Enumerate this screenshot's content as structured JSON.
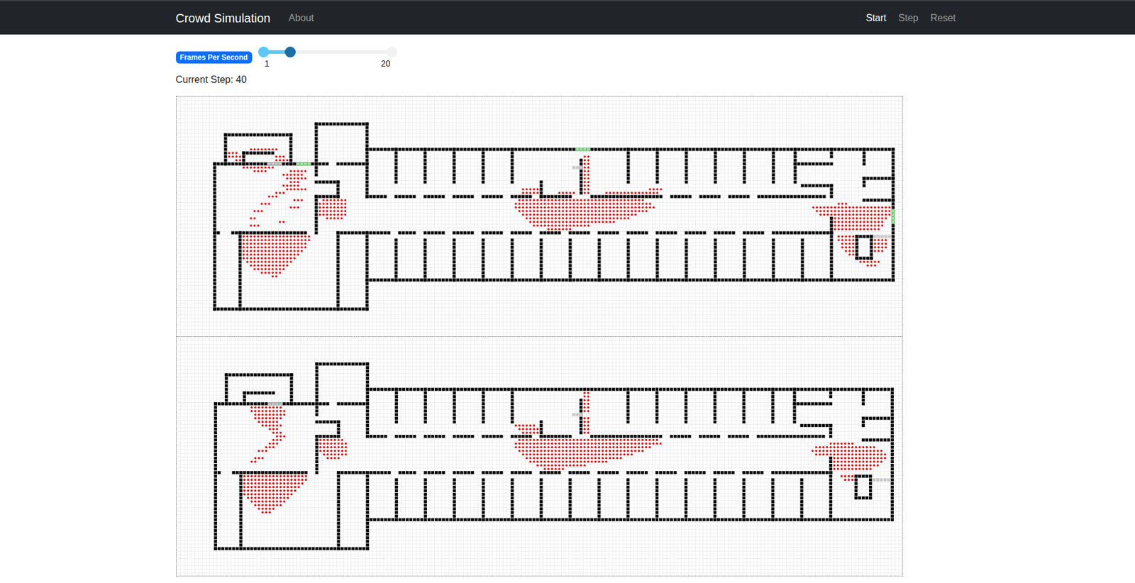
{
  "navbar": {
    "brand": "Crowd Simulation",
    "links": [
      {
        "label": "About"
      }
    ],
    "actions": [
      {
        "label": "Start",
        "selected": true
      },
      {
        "label": "Step",
        "selected": false
      },
      {
        "label": "Reset",
        "selected": false
      }
    ]
  },
  "fps_slider": {
    "label": "Frames Per Second",
    "min": "1",
    "max": "20",
    "level": 0.21
  },
  "current_step": "Current Step: 40",
  "map": {
    "walls": [
      [
        13,
        10,
        31,
        10
      ],
      [
        13,
        10,
        13,
        18
      ],
      [
        31,
        10,
        31,
        18
      ],
      [
        10,
        18,
        41,
        18
      ],
      [
        10,
        18,
        10,
        58
      ],
      [
        18,
        15,
        26,
        15
      ],
      [
        18,
        15,
        18,
        18
      ],
      [
        38,
        7,
        52,
        7
      ],
      [
        38,
        7,
        38,
        21
      ],
      [
        52,
        7,
        52,
        27
      ],
      [
        44,
        18,
        52,
        18
      ],
      [
        38,
        23,
        44,
        23
      ],
      [
        44,
        23,
        44,
        27
      ],
      [
        38,
        27,
        44,
        27
      ],
      [
        38,
        27,
        38,
        37
      ],
      [
        52,
        14,
        197,
        14
      ],
      [
        197,
        14,
        197,
        50
      ],
      [
        52,
        50,
        197,
        50
      ],
      [
        10,
        58,
        52,
        58
      ],
      [
        52,
        37,
        52,
        58
      ],
      [
        17,
        37,
        17,
        58
      ],
      [
        44,
        37,
        44,
        58
      ],
      [
        52,
        27,
        57,
        27
      ],
      [
        60,
        27,
        65,
        27
      ],
      [
        68,
        27,
        73,
        27
      ],
      [
        76,
        27,
        81,
        27
      ],
      [
        84,
        27,
        89,
        27
      ],
      [
        92,
        27,
        97,
        27
      ],
      [
        100,
        27,
        108,
        27
      ],
      [
        114,
        27,
        133,
        27
      ],
      [
        136,
        27,
        141,
        27
      ],
      [
        144,
        27,
        149,
        27
      ],
      [
        152,
        27,
        157,
        27
      ],
      [
        160,
        27,
        178,
        27
      ],
      [
        60,
        14,
        60,
        23
      ],
      [
        68,
        14,
        68,
        23
      ],
      [
        76,
        14,
        76,
        23
      ],
      [
        84,
        14,
        84,
        23
      ],
      [
        92,
        14,
        92,
        23
      ],
      [
        100,
        23,
        100,
        27
      ],
      [
        111,
        17,
        111,
        26
      ],
      [
        124,
        14,
        124,
        23
      ],
      [
        132,
        14,
        132,
        23
      ],
      [
        140,
        14,
        140,
        23
      ],
      [
        148,
        14,
        148,
        23
      ],
      [
        156,
        14,
        156,
        23
      ],
      [
        164,
        14,
        164,
        23
      ],
      [
        170,
        14,
        170,
        23
      ],
      [
        170,
        18,
        180,
        18
      ],
      [
        172,
        24,
        180,
        24
      ],
      [
        180,
        14,
        180,
        16
      ],
      [
        180,
        24,
        180,
        27
      ],
      [
        189,
        14,
        189,
        18
      ],
      [
        189,
        22,
        197,
        22
      ],
      [
        189,
        22,
        189,
        24
      ],
      [
        189,
        28,
        197,
        28
      ],
      [
        180,
        33,
        180,
        37
      ],
      [
        10,
        37,
        11,
        37
      ],
      [
        15,
        37,
        35,
        37
      ],
      [
        44,
        37,
        58,
        37
      ],
      [
        61,
        37,
        65,
        37
      ],
      [
        68,
        37,
        73,
        37
      ],
      [
        76,
        37,
        81,
        37
      ],
      [
        84,
        37,
        89,
        37
      ],
      [
        92,
        37,
        97,
        37
      ],
      [
        100,
        37,
        105,
        37
      ],
      [
        108,
        37,
        113,
        37
      ],
      [
        116,
        37,
        121,
        37
      ],
      [
        124,
        37,
        129,
        37
      ],
      [
        132,
        37,
        137,
        37
      ],
      [
        140,
        37,
        145,
        37
      ],
      [
        148,
        37,
        153,
        37
      ],
      [
        156,
        37,
        161,
        37
      ],
      [
        164,
        37,
        180,
        37
      ],
      [
        60,
        39,
        60,
        50
      ],
      [
        68,
        39,
        68,
        50
      ],
      [
        76,
        39,
        76,
        50
      ],
      [
        84,
        39,
        84,
        50
      ],
      [
        92,
        39,
        92,
        50
      ],
      [
        100,
        39,
        100,
        50
      ],
      [
        108,
        39,
        108,
        50
      ],
      [
        116,
        39,
        116,
        50
      ],
      [
        124,
        39,
        124,
        50
      ],
      [
        132,
        39,
        132,
        50
      ],
      [
        140,
        39,
        140,
        50
      ],
      [
        148,
        39,
        148,
        50
      ],
      [
        156,
        39,
        156,
        50
      ],
      [
        164,
        39,
        164,
        50
      ],
      [
        172,
        39,
        172,
        50
      ],
      [
        180,
        37,
        180,
        50
      ],
      [
        187,
        38,
        191,
        38
      ],
      [
        187,
        38,
        187,
        44
      ],
      [
        191,
        38,
        191,
        44
      ],
      [
        187,
        44,
        191,
        44
      ]
    ]
  },
  "panels": [
    {
      "exits": [
        {
          "cells": [
            25,
            18,
            28,
            18
          ],
          "color": "#c8c8c8"
        },
        {
          "cells": [
            33,
            18,
            36,
            18
          ],
          "color": "#90ee90"
        },
        {
          "cells": [
            110,
            14,
            113,
            14
          ],
          "color": "#90ee90"
        },
        {
          "cells": [
            109,
            19,
            111,
            19
          ],
          "color": "#c8c8c8"
        },
        {
          "cells": [
            197,
            31,
            197,
            34
          ],
          "color": "#90ee90"
        },
        {
          "cells": [
            192,
            38,
            196,
            38
          ],
          "color": "#c8c8c8"
        }
      ],
      "agents": [
        [
          38,
          18,
          36
        ],
        [
          39,
          18,
          36
        ],
        [
          40,
          18,
          35
        ],
        [
          41,
          18,
          35
        ],
        [
          42,
          18,
          34
        ],
        [
          43,
          18,
          33
        ],
        [
          44,
          18,
          32
        ],
        [
          45,
          19,
          31
        ],
        [
          46,
          20,
          30
        ],
        [
          47,
          21,
          29
        ],
        [
          48,
          23,
          28
        ],
        [
          49,
          26,
          27
        ],
        [
          20,
          31,
          35
        ],
        [
          21,
          29,
          34
        ],
        [
          22,
          30,
          35
        ],
        [
          23,
          31,
          33
        ],
        [
          24,
          29,
          33
        ],
        [
          25,
          30,
          35
        ],
        [
          26,
          27,
          29
        ],
        [
          27,
          25,
          27
        ],
        [
          28,
          32,
          34
        ],
        [
          29,
          23,
          25
        ],
        [
          30,
          31,
          33
        ],
        [
          31,
          21,
          23
        ],
        [
          33,
          20,
          21
        ],
        [
          34,
          28,
          29
        ],
        [
          35,
          20,
          22
        ],
        [
          14,
          20,
          27
        ],
        [
          15,
          14,
          16
        ],
        [
          16,
          14,
          17
        ],
        [
          17,
          16,
          17
        ],
        [
          19,
          18,
          26
        ],
        [
          20,
          21,
          24
        ],
        [
          16,
          27,
          29
        ],
        [
          17,
          27,
          30
        ],
        [
          28,
          40,
          46
        ],
        [
          29,
          39,
          46
        ],
        [
          30,
          39,
          46
        ],
        [
          31,
          39,
          46
        ],
        [
          32,
          39,
          46
        ],
        [
          33,
          41,
          45
        ],
        [
          25,
          95,
          99
        ],
        [
          25,
          130,
          133
        ],
        [
          26,
          95,
          99
        ],
        [
          26,
          105,
          109
        ],
        [
          26,
          118,
          132
        ],
        [
          28,
          94,
          128
        ],
        [
          29,
          93,
          130
        ],
        [
          30,
          93,
          131
        ],
        [
          31,
          94,
          129
        ],
        [
          32,
          95,
          126
        ],
        [
          33,
          96,
          124
        ],
        [
          34,
          97,
          120
        ],
        [
          35,
          98,
          113
        ],
        [
          36,
          102,
          108
        ],
        [
          16,
          112,
          113
        ],
        [
          17,
          112,
          113
        ],
        [
          18,
          112,
          113
        ],
        [
          19,
          112,
          113
        ],
        [
          20,
          112,
          113
        ],
        [
          21,
          112,
          113
        ],
        [
          22,
          112,
          113
        ],
        [
          23,
          112,
          113
        ],
        [
          24,
          112,
          113
        ],
        [
          25,
          112,
          113
        ],
        [
          26,
          112,
          113
        ],
        [
          29,
          182,
          184
        ],
        [
          30,
          175,
          196
        ],
        [
          31,
          176,
          196
        ],
        [
          32,
          177,
          196
        ],
        [
          33,
          181,
          195
        ],
        [
          34,
          181,
          194
        ],
        [
          35,
          181,
          194
        ],
        [
          36,
          181,
          193
        ],
        [
          38,
          182,
          186
        ],
        [
          39,
          182,
          186
        ],
        [
          40,
          183,
          186
        ],
        [
          41,
          183,
          186
        ],
        [
          42,
          184,
          186
        ],
        [
          43,
          185,
          186
        ],
        [
          39,
          192,
          195
        ],
        [
          40,
          192,
          195
        ],
        [
          41,
          192,
          195
        ],
        [
          42,
          192,
          194
        ],
        [
          45,
          188,
          193
        ],
        [
          46,
          190,
          192
        ]
      ]
    },
    {
      "exits": [
        {
          "cells": [
            25,
            18,
            28,
            18
          ],
          "color": "#c8c8c8"
        },
        {
          "cells": [
            109,
            21,
            111,
            21
          ],
          "color": "#c8c8c8"
        },
        {
          "cells": [
            192,
            39,
            196,
            39
          ],
          "color": "#c8c8c8"
        }
      ],
      "agents": [
        [
          38,
          18,
          35
        ],
        [
          39,
          18,
          35
        ],
        [
          40,
          18,
          34
        ],
        [
          41,
          18,
          33
        ],
        [
          42,
          18,
          32
        ],
        [
          43,
          18,
          31
        ],
        [
          44,
          19,
          30
        ],
        [
          45,
          20,
          29
        ],
        [
          46,
          21,
          28
        ],
        [
          47,
          22,
          26
        ],
        [
          48,
          23,
          25
        ],
        [
          19,
          20,
          28
        ],
        [
          20,
          20,
          29
        ],
        [
          21,
          21,
          29
        ],
        [
          22,
          21,
          28
        ],
        [
          23,
          22,
          27
        ],
        [
          24,
          23,
          28
        ],
        [
          25,
          25,
          27
        ],
        [
          26,
          26,
          28
        ],
        [
          27,
          27,
          29
        ],
        [
          28,
          26,
          28
        ],
        [
          29,
          25,
          27
        ],
        [
          30,
          24,
          26
        ],
        [
          31,
          22,
          24
        ],
        [
          33,
          21,
          23
        ],
        [
          34,
          20,
          21
        ],
        [
          28,
          39,
          45
        ],
        [
          29,
          39,
          46
        ],
        [
          30,
          39,
          46
        ],
        [
          31,
          39,
          46
        ],
        [
          32,
          40,
          46
        ],
        [
          33,
          41,
          44
        ],
        [
          24,
          93,
          98
        ],
        [
          25,
          94,
          99
        ],
        [
          26,
          95,
          99
        ],
        [
          28,
          94,
          132
        ],
        [
          29,
          93,
          133
        ],
        [
          30,
          93,
          130
        ],
        [
          31,
          94,
          128
        ],
        [
          32,
          95,
          125
        ],
        [
          33,
          96,
          122
        ],
        [
          34,
          97,
          118
        ],
        [
          35,
          99,
          112
        ],
        [
          36,
          101,
          106
        ],
        [
          15,
          112,
          113
        ],
        [
          16,
          112,
          113
        ],
        [
          17,
          112,
          113
        ],
        [
          18,
          112,
          113
        ],
        [
          19,
          112,
          113
        ],
        [
          20,
          112,
          113
        ],
        [
          22,
          112,
          113
        ],
        [
          23,
          112,
          113
        ],
        [
          24,
          112,
          113
        ],
        [
          25,
          112,
          113
        ],
        [
          26,
          112,
          113
        ],
        [
          29,
          180,
          186
        ],
        [
          30,
          176,
          192
        ],
        [
          31,
          175,
          194
        ],
        [
          32,
          176,
          195
        ],
        [
          33,
          181,
          195
        ],
        [
          34,
          181,
          194
        ],
        [
          35,
          181,
          193
        ],
        [
          36,
          181,
          191
        ],
        [
          38,
          183,
          186
        ],
        [
          39,
          184,
          186
        ]
      ]
    }
  ]
}
